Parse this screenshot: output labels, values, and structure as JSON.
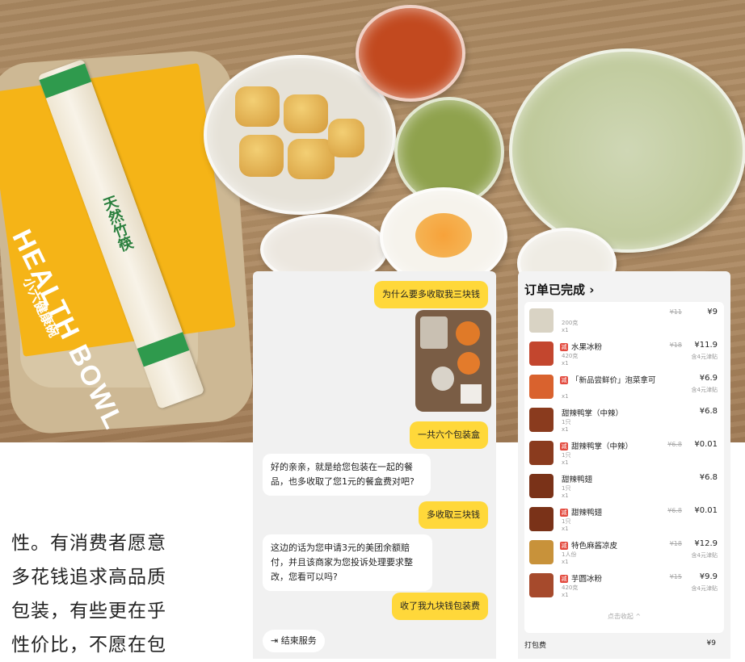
{
  "photo": {
    "sleeve_brand_en": "HEALTH BOWL",
    "sleeve_brand_cn": "小六健康碗",
    "chopsticks_label": "天然竹筷"
  },
  "article": {
    "lines": [
      "性。有消费者愿意",
      "多花钱追求高品质",
      "包装，有些更在乎",
      "性价比，不愿在包"
    ]
  },
  "chat": {
    "messages": [
      {
        "from": "me",
        "text": "为什么要多收取我三块钱"
      },
      {
        "from": "me",
        "text": "一共六个包装盒"
      },
      {
        "from": "them",
        "text": "好的亲亲，就是给您包装在一起的餐品，也多收取了您1元的餐盒费对吧?"
      },
      {
        "from": "me",
        "text": "多收取三块钱"
      },
      {
        "from": "them",
        "text": "这边的话为您申请3元的美团余额赔付，并且该商家为您投诉处理要求整改，您看可以吗?"
      },
      {
        "from": "me",
        "text": "收了我九块钱包装费"
      }
    ],
    "end_button": "结束服务",
    "end_icon": "exit-icon"
  },
  "order": {
    "title": "订单已完成 ›",
    "items": [
      {
        "name": "",
        "sub1": "200克",
        "sub2": "x1",
        "old": "¥11",
        "price": "¥9",
        "note": "",
        "tag": false,
        "color": "#d9d3c4"
      },
      {
        "name": "水果冰粉",
        "sub1": "420克",
        "sub2": "x1",
        "old": "¥18",
        "price": "¥11.9",
        "note": "含4元津贴",
        "tag": true,
        "color": "#c3462e"
      },
      {
        "name": "「新品尝鲜价」泡菜拿可",
        "sub1": "",
        "sub2": "x1",
        "old": "",
        "price": "¥6.9",
        "note": "含4元津贴",
        "tag": true,
        "color": "#d9622e"
      },
      {
        "name": "甜辣鸭掌（中辣）",
        "sub1": "1只",
        "sub2": "x1",
        "old": "",
        "price": "¥6.8",
        "note": "",
        "tag": false,
        "color": "#8a3b1e"
      },
      {
        "name": "甜辣鸭掌（中辣）",
        "sub1": "1只",
        "sub2": "x1",
        "old": "¥6.8",
        "price": "¥0.01",
        "note": "",
        "tag": true,
        "color": "#8a3b1e"
      },
      {
        "name": "甜辣鸭翅",
        "sub1": "1只",
        "sub2": "x1",
        "old": "",
        "price": "¥6.8",
        "note": "",
        "tag": false,
        "color": "#7a3218"
      },
      {
        "name": "甜辣鸭翅",
        "sub1": "1只",
        "sub2": "x1",
        "old": "¥6.8",
        "price": "¥0.01",
        "note": "",
        "tag": true,
        "color": "#7a3218"
      },
      {
        "name": "特色麻酱凉皮",
        "sub1": "1人份",
        "sub2": "x1",
        "old": "¥18",
        "price": "¥12.9",
        "note": "含4元津贴",
        "tag": true,
        "color": "#c8923a"
      },
      {
        "name": "芋圆冰粉",
        "sub1": "420克",
        "sub2": "x1",
        "old": "¥15",
        "price": "¥9.9",
        "note": "含4元津贴",
        "tag": true,
        "color": "#a64a2c"
      }
    ],
    "collapse_label": "点击收起 ^",
    "packaging_label": "打包费",
    "packaging_value": "¥9"
  }
}
